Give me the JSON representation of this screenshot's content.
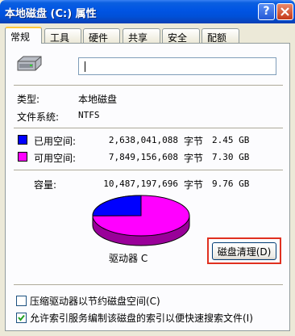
{
  "title": "本地磁盘 (C:) 属性",
  "help_label": "?",
  "tabs": [
    {
      "label": "常规"
    },
    {
      "label": "工具"
    },
    {
      "label": "硬件"
    },
    {
      "label": "共享"
    },
    {
      "label": "安全"
    },
    {
      "label": "配额"
    }
  ],
  "drive_name_value": "",
  "type_label": "类型:",
  "type_value": "本地磁盘",
  "fs_label": "文件系统:",
  "fs_value": "NTFS",
  "used": {
    "label": "已用空间:",
    "bytes": "2,638,041,088",
    "unit": "字节",
    "size": "2.45 GB",
    "color": "#0000ff"
  },
  "free": {
    "label": "可用空间:",
    "bytes": "7,849,156,608",
    "unit": "字节",
    "size": "7.30 GB",
    "color": "#ff00ff"
  },
  "capacity": {
    "label": "容量:",
    "bytes": "10,487,197,696",
    "unit": "字节",
    "size": "9.76 GB"
  },
  "drive_label": "驱动器 C",
  "cleanup_button": "磁盘清理(D)",
  "compress_option": {
    "label": "压缩驱动器以节约磁盘空间(C)",
    "checked": false
  },
  "index_option": {
    "label": "允许索引服务编制该磁盘的索引以便快速搜索文件(I)",
    "checked": true
  },
  "usage_fraction_used": 0.2515
}
